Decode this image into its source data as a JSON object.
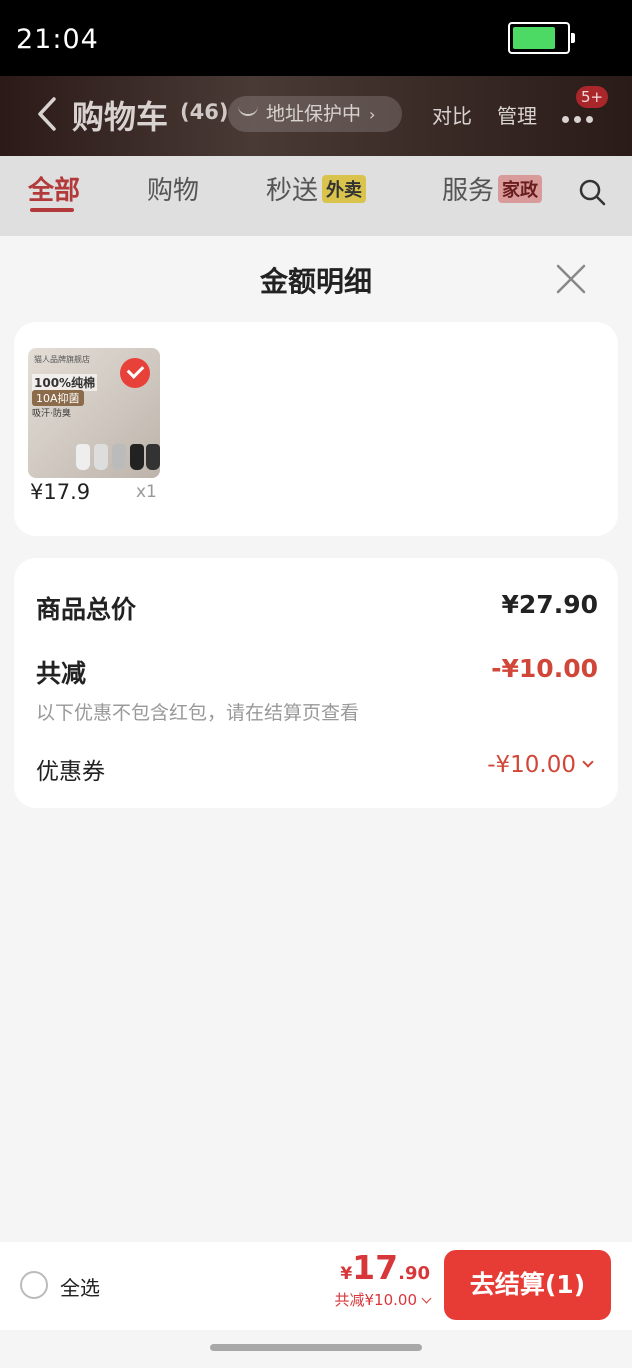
{
  "status_bar": {
    "time": "21:04",
    "battery_level": 0.8,
    "battery_color": "#4cd964"
  },
  "header": {
    "title": "购物车",
    "count": "(46)",
    "address_protect": "地址保护中",
    "compare": "对比",
    "manage": "管理",
    "badge": "5+"
  },
  "tabs": [
    {
      "label": "全部",
      "tag": ""
    },
    {
      "label": "购物",
      "tag": ""
    },
    {
      "label": "秒送",
      "tag": "外卖"
    },
    {
      "label": "服务",
      "tag": "家政"
    }
  ],
  "sheet": {
    "title": "金额明细",
    "product": {
      "brand_text": "猫人品牌旗舰店",
      "image_text_1": "100%纯棉",
      "image_text_2": "10A抑菌",
      "image_text_3": "吸汗·防臭",
      "price": "¥17.9",
      "qty": "x1"
    },
    "summary": {
      "total_label": "商品总价",
      "total_value": "¥27.90",
      "reduce_label": "共减",
      "reduce_value": "-¥10.00",
      "note": "以下优惠不包含红包，请在结算页查看",
      "coupon_label": "优惠券",
      "coupon_value": "-¥10.00"
    }
  },
  "bottom_bar": {
    "select_all": "全选",
    "total_yen": "¥",
    "total_int": "17",
    "total_dec": ".90",
    "discount": "共减¥10.00",
    "checkout": "去结算(1)"
  },
  "colors": {
    "accent": "#e73c36",
    "price_red": "#d7373a"
  }
}
